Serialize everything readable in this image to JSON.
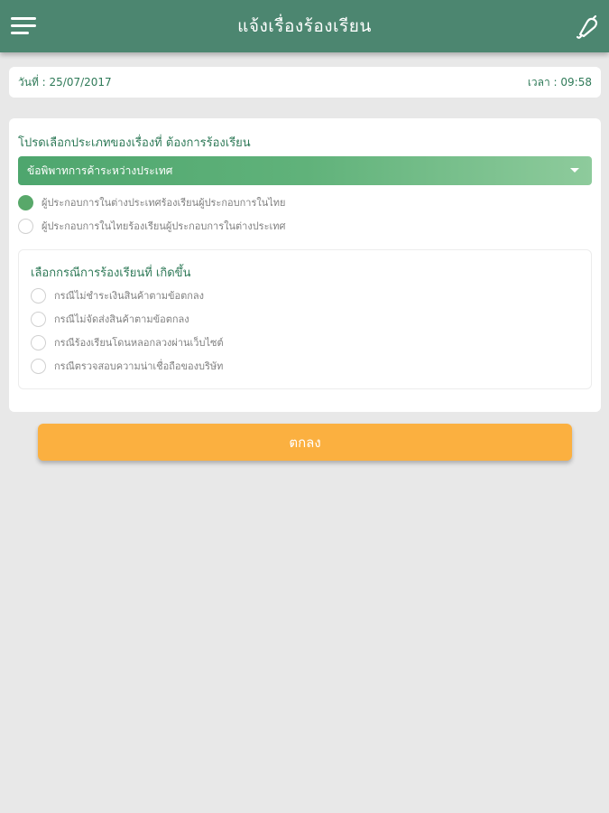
{
  "header": {
    "title": "แจ้งเรื่องร้องเรียน",
    "menu_icon": "hamburger-menu-icon",
    "bell_icon": "bell-icon",
    "color": "#4c8670"
  },
  "date_bar": {
    "date_text": "วันที่ : 25/07/2017",
    "time_text": "เวลา : 09:58"
  },
  "complaint_type": {
    "prompt": "โปรดเลือกประเภทของเรื่องที่ ต้องการร้องเรียน",
    "selected_category": "ข้อพิพาทการค้าระหว่างประเทศ",
    "options": [
      {
        "label": "ผู้ประกอบการในต่างประเทศร้องเรียนผู้ประกอบการในไทย",
        "selected": true
      },
      {
        "label": "ผู้ประกอบการในไทยร้องเรียนผู้ประกอบการในต่างประเทศ",
        "selected": false
      }
    ]
  },
  "case_section": {
    "title": "เลือกกรณีการร้องเรียนที่ เกิดขึ้น",
    "options": [
      {
        "label": "กรณีไม่ชำระเงินสินค้าตามข้อตกลง",
        "selected": false
      },
      {
        "label": "กรณีไม่จัดส่งสินค้าตามข้อตกลง",
        "selected": false
      },
      {
        "label": "กรณีร้องเรียนโดนหลอกลวงผ่านเว็บไซต์",
        "selected": false
      },
      {
        "label": "กรณีตรวจสอบความน่าเชื่อถือของบริษัท",
        "selected": false
      }
    ]
  },
  "submit": {
    "label": "ตกลง",
    "color": "#fbb040"
  }
}
